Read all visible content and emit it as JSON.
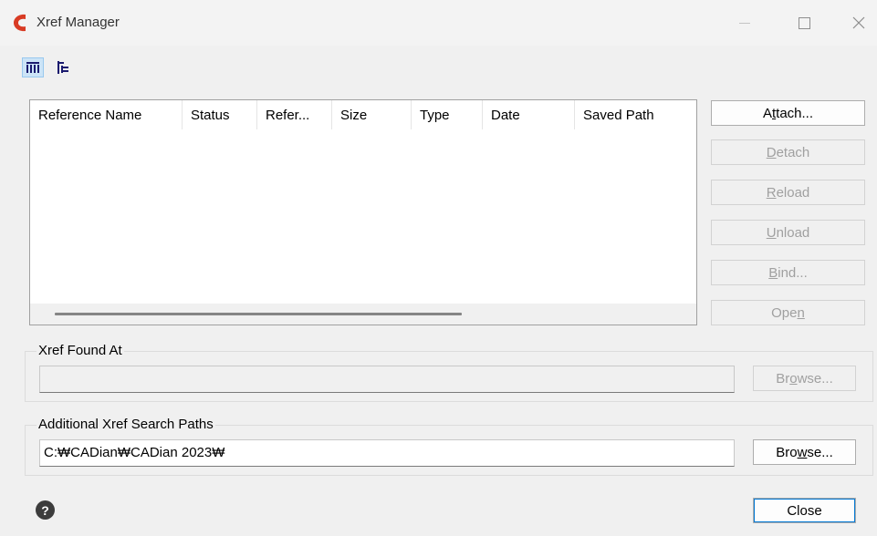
{
  "window": {
    "title": "Xref Manager",
    "accent_color": "#d83b24"
  },
  "toolbar": {
    "list_view_icon": "list-view-icon",
    "tree_view_icon": "tree-view-icon"
  },
  "list": {
    "columns": [
      "Reference Name",
      "Status",
      "Refer...",
      "Size",
      "Type",
      "Date",
      "Saved Path"
    ]
  },
  "buttons": {
    "attach": {
      "pre": "A",
      "u": "t",
      "post": "tach..."
    },
    "detach": {
      "pre": "",
      "u": "D",
      "post": "etach"
    },
    "reload": {
      "pre": "",
      "u": "R",
      "post": "eload"
    },
    "unload": {
      "pre": "",
      "u": "U",
      "post": "nload"
    },
    "bind": {
      "pre": "",
      "u": "B",
      "post": "ind..."
    },
    "open": {
      "pre": "Ope",
      "u": "n",
      "post": ""
    }
  },
  "xref_found": {
    "label": "Xref Found At",
    "value": "",
    "browse": {
      "pre": "Br",
      "u": "o",
      "post": "wse..."
    }
  },
  "search_paths": {
    "label": "Additional Xref Search Paths",
    "value": "C:₩CADian₩CADian 2023₩",
    "browse": {
      "pre": "Bro",
      "u": "w",
      "post": "se..."
    }
  },
  "footer": {
    "help_icon": "help-icon",
    "close_label": "Close"
  }
}
